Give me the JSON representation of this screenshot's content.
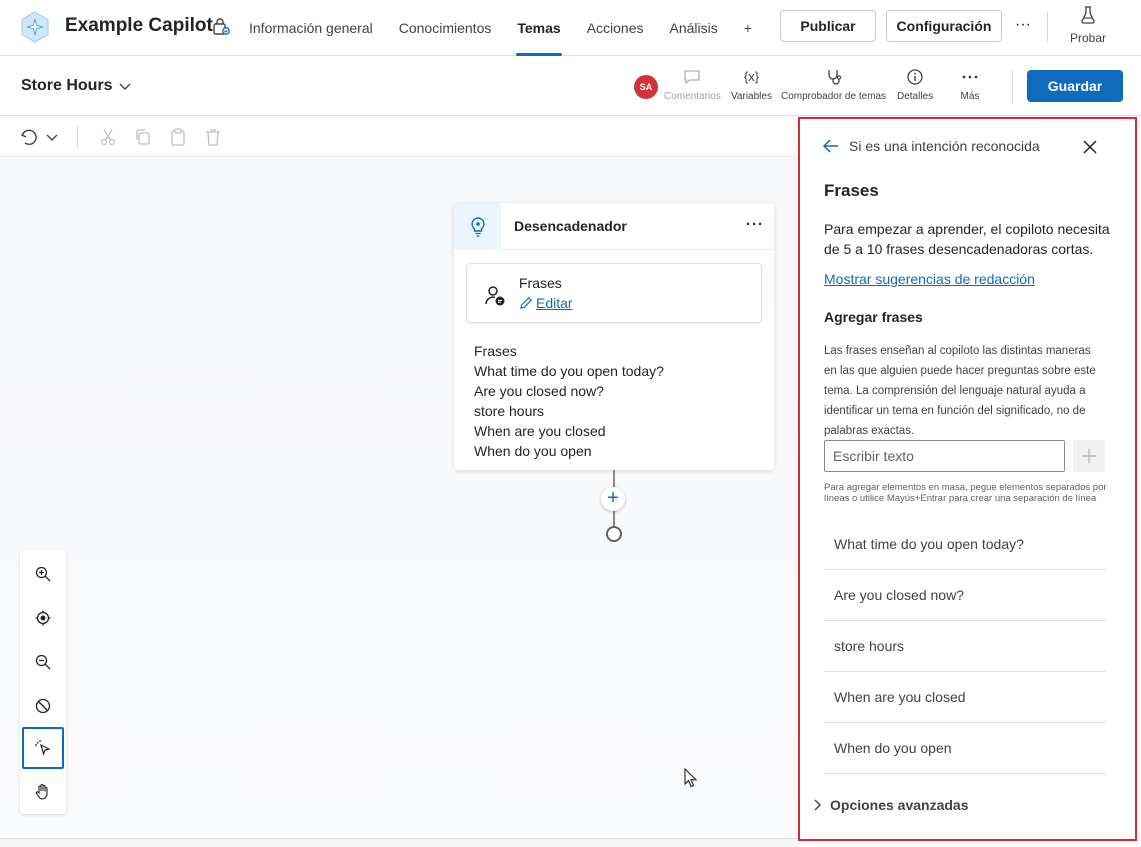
{
  "app": {
    "title": "Example Capilot",
    "nav_tabs": [
      {
        "label": "Información general"
      },
      {
        "label": "Conocimientos"
      },
      {
        "label": "Temas",
        "active": true
      },
      {
        "label": "Acciones"
      },
      {
        "label": "Análisis"
      },
      {
        "label": "+"
      }
    ],
    "publish_label": "Publicar",
    "config_label": "Configuración",
    "more_label": "···",
    "test_label": "Probar"
  },
  "topic": {
    "name": "Store Hours",
    "avatar_initials": "SA",
    "tools": {
      "comments": "Comentarios",
      "variables": "Variables",
      "checker": "Comprobador de temas",
      "details": "Detalles",
      "more": "Más"
    },
    "variables_glyph": "{x}",
    "save_label": "Guardar"
  },
  "canvas": {
    "trigger": {
      "title": "Desencadenador",
      "more": "···",
      "phrases_title": "Frases",
      "edit_label": "Editar",
      "body_title": "Frases",
      "phrases": [
        "What time do you open today?",
        "Are you closed now?",
        "store hours",
        "When are you closed",
        "When do you open"
      ]
    },
    "add_node": "+"
  },
  "panel": {
    "breadcrumb": "Si es una intención reconocida",
    "heading": "Frases",
    "description": "Para empezar a aprender, el copiloto necesita de 5 a 10 frases desencadenadoras cortas.",
    "suggestions_link": "Mostrar sugerencias de redacción",
    "add_heading": "Agregar frases",
    "add_info": "Las frases enseñan al copiloto las distintas maneras en las que alguien puede hacer preguntas sobre este tema. La comprensión del lenguaje natural ayuda a identificar un tema en función del significado, no de palabras exactas.",
    "input_placeholder": "Escribir texto",
    "hint": "Para agregar elementos en masa, pegue elementos separados por líneas o utilice Mayús+Entrar para crear una separación de línea",
    "phrases": [
      "What time do you open today?",
      "Are you closed now?",
      "store hours",
      "When are you closed",
      "When do you open"
    ],
    "advanced_label": "Opciones avanzadas"
  },
  "colors": {
    "accent": "#0f6cbd",
    "highlight_border": "#d42b34",
    "avatar": "#d13438"
  }
}
